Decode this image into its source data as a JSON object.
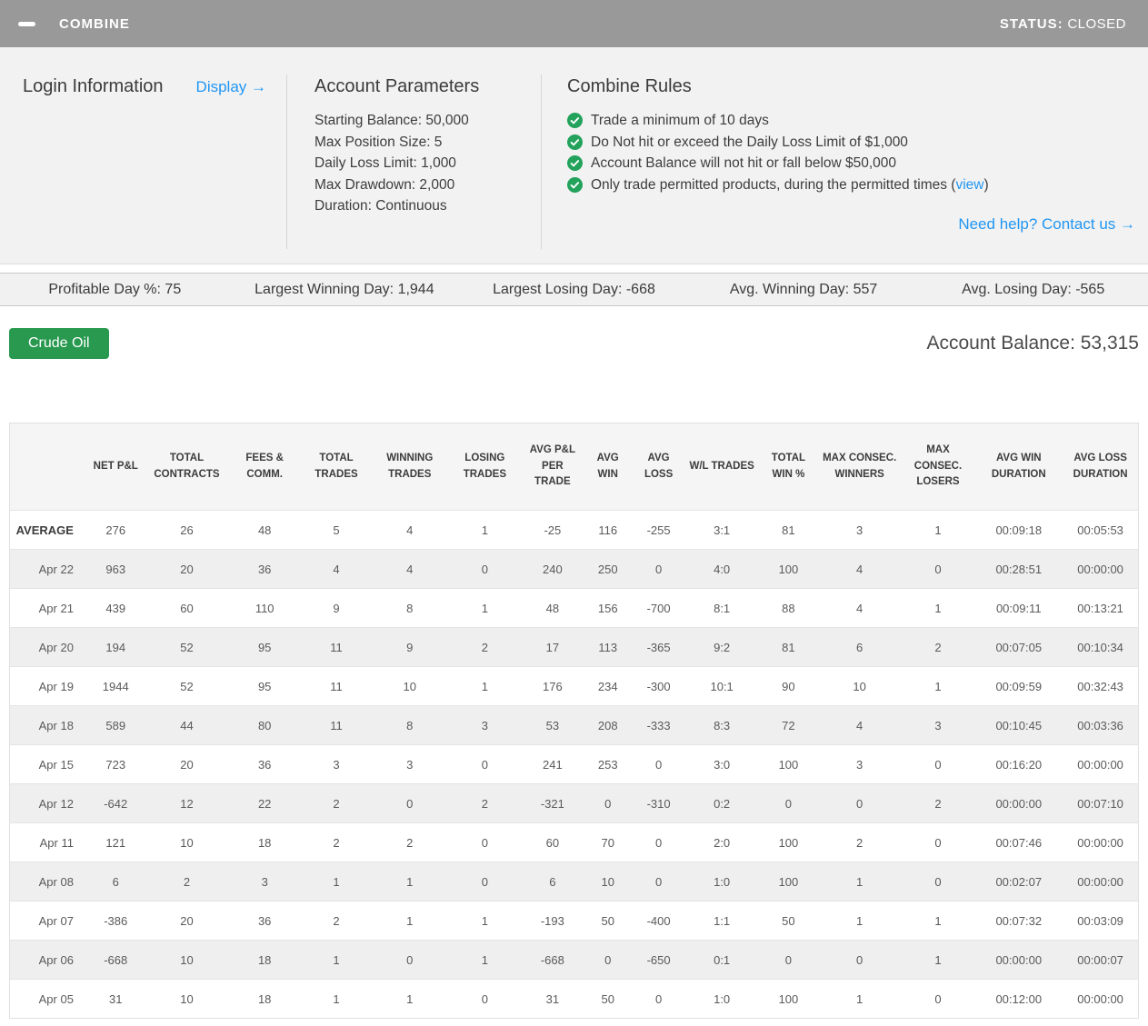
{
  "colors": {
    "titlebar_gray": "#999999",
    "panel_gray": "#f2f2f2",
    "link_blue": "#2196f3",
    "check_green": "#22a25b",
    "button_green": "#28994f"
  },
  "titlebar": {
    "title": "COMBINE",
    "status_label": "STATUS:",
    "status_value": "CLOSED"
  },
  "panel": {
    "login": {
      "heading": "Login Information",
      "display_link": "Display →"
    },
    "account_parameters": {
      "heading": "Account Parameters",
      "items": [
        "Starting Balance: 50,000",
        "Max Position Size: 5",
        "Daily Loss Limit: 1,000",
        "Max Drawdown: 2,000",
        "Duration: Continuous"
      ]
    },
    "combine_rules": {
      "heading": "Combine Rules",
      "rules": [
        {
          "pre": "Trade a minimum of 10 days",
          "link": "",
          "post": ""
        },
        {
          "pre": "Do Not hit or exceed the Daily Loss Limit of $1,000",
          "link": "",
          "post": ""
        },
        {
          "pre": "Account Balance will not hit or fall below $50,000",
          "link": "",
          "post": ""
        },
        {
          "pre": "Only trade permitted products, during the permitted times (",
          "link": "view",
          "post": ")"
        }
      ]
    },
    "help_link": "Need help? Contact us →"
  },
  "stats_bar": [
    "Profitable Day %: 75",
    "Largest Winning Day: 1,944",
    "Largest Losing Day: -668",
    "Avg. Winning Day: 557",
    "Avg. Losing Day: -565"
  ],
  "balance_row": {
    "product_button": "Crude Oil",
    "account_balance": "Account Balance: 53,315"
  },
  "table": {
    "columns": [
      "",
      "NET P&L",
      "TOTAL CONTRACTS",
      "FEES & COMM.",
      "TOTAL TRADES",
      "WINNING TRADES",
      "LOSING TRADES",
      "AVG P&L PER TRADE",
      "AVG WIN",
      "AVG LOSS",
      "W/L TRADES",
      "TOTAL WIN %",
      "MAX CONSEC. WINNERS",
      "MAX CONSEC. LOSERS",
      "AVG WIN DURATION",
      "AVG LOSS DURATION"
    ],
    "rows": [
      {
        "label": "AVERAGE",
        "values": [
          "276",
          "26",
          "48",
          "5",
          "4",
          "1",
          "-25",
          "116",
          "-255",
          "3:1",
          "81",
          "3",
          "1",
          "00:09:18",
          "00:05:53"
        ]
      },
      {
        "label": "Apr 22",
        "values": [
          "963",
          "20",
          "36",
          "4",
          "4",
          "0",
          "240",
          "250",
          "0",
          "4:0",
          "100",
          "4",
          "0",
          "00:28:51",
          "00:00:00"
        ]
      },
      {
        "label": "Apr 21",
        "values": [
          "439",
          "60",
          "110",
          "9",
          "8",
          "1",
          "48",
          "156",
          "-700",
          "8:1",
          "88",
          "4",
          "1",
          "00:09:11",
          "00:13:21"
        ]
      },
      {
        "label": "Apr 20",
        "values": [
          "194",
          "52",
          "95",
          "11",
          "9",
          "2",
          "17",
          "113",
          "-365",
          "9:2",
          "81",
          "6",
          "2",
          "00:07:05",
          "00:10:34"
        ]
      },
      {
        "label": "Apr 19",
        "values": [
          "1944",
          "52",
          "95",
          "11",
          "10",
          "1",
          "176",
          "234",
          "-300",
          "10:1",
          "90",
          "10",
          "1",
          "00:09:59",
          "00:32:43"
        ]
      },
      {
        "label": "Apr 18",
        "values": [
          "589",
          "44",
          "80",
          "11",
          "8",
          "3",
          "53",
          "208",
          "-333",
          "8:3",
          "72",
          "4",
          "3",
          "00:10:45",
          "00:03:36"
        ]
      },
      {
        "label": "Apr 15",
        "values": [
          "723",
          "20",
          "36",
          "3",
          "3",
          "0",
          "241",
          "253",
          "0",
          "3:0",
          "100",
          "3",
          "0",
          "00:16:20",
          "00:00:00"
        ]
      },
      {
        "label": "Apr 12",
        "values": [
          "-642",
          "12",
          "22",
          "2",
          "0",
          "2",
          "-321",
          "0",
          "-310",
          "0:2",
          "0",
          "0",
          "2",
          "00:00:00",
          "00:07:10"
        ]
      },
      {
        "label": "Apr 11",
        "values": [
          "121",
          "10",
          "18",
          "2",
          "2",
          "0",
          "60",
          "70",
          "0",
          "2:0",
          "100",
          "2",
          "0",
          "00:07:46",
          "00:00:00"
        ]
      },
      {
        "label": "Apr 08",
        "values": [
          "6",
          "2",
          "3",
          "1",
          "1",
          "0",
          "6",
          "10",
          "0",
          "1:0",
          "100",
          "1",
          "0",
          "00:02:07",
          "00:00:00"
        ]
      },
      {
        "label": "Apr 07",
        "values": [
          "-386",
          "20",
          "36",
          "2",
          "1",
          "1",
          "-193",
          "50",
          "-400",
          "1:1",
          "50",
          "1",
          "1",
          "00:07:32",
          "00:03:09"
        ]
      },
      {
        "label": "Apr 06",
        "values": [
          "-668",
          "10",
          "18",
          "1",
          "0",
          "1",
          "-668",
          "0",
          "-650",
          "0:1",
          "0",
          "0",
          "1",
          "00:00:00",
          "00:00:07"
        ]
      },
      {
        "label": "Apr 05",
        "values": [
          "31",
          "10",
          "18",
          "1",
          "1",
          "0",
          "31",
          "50",
          "0",
          "1:0",
          "100",
          "1",
          "0",
          "00:12:00",
          "00:00:00"
        ]
      }
    ]
  }
}
